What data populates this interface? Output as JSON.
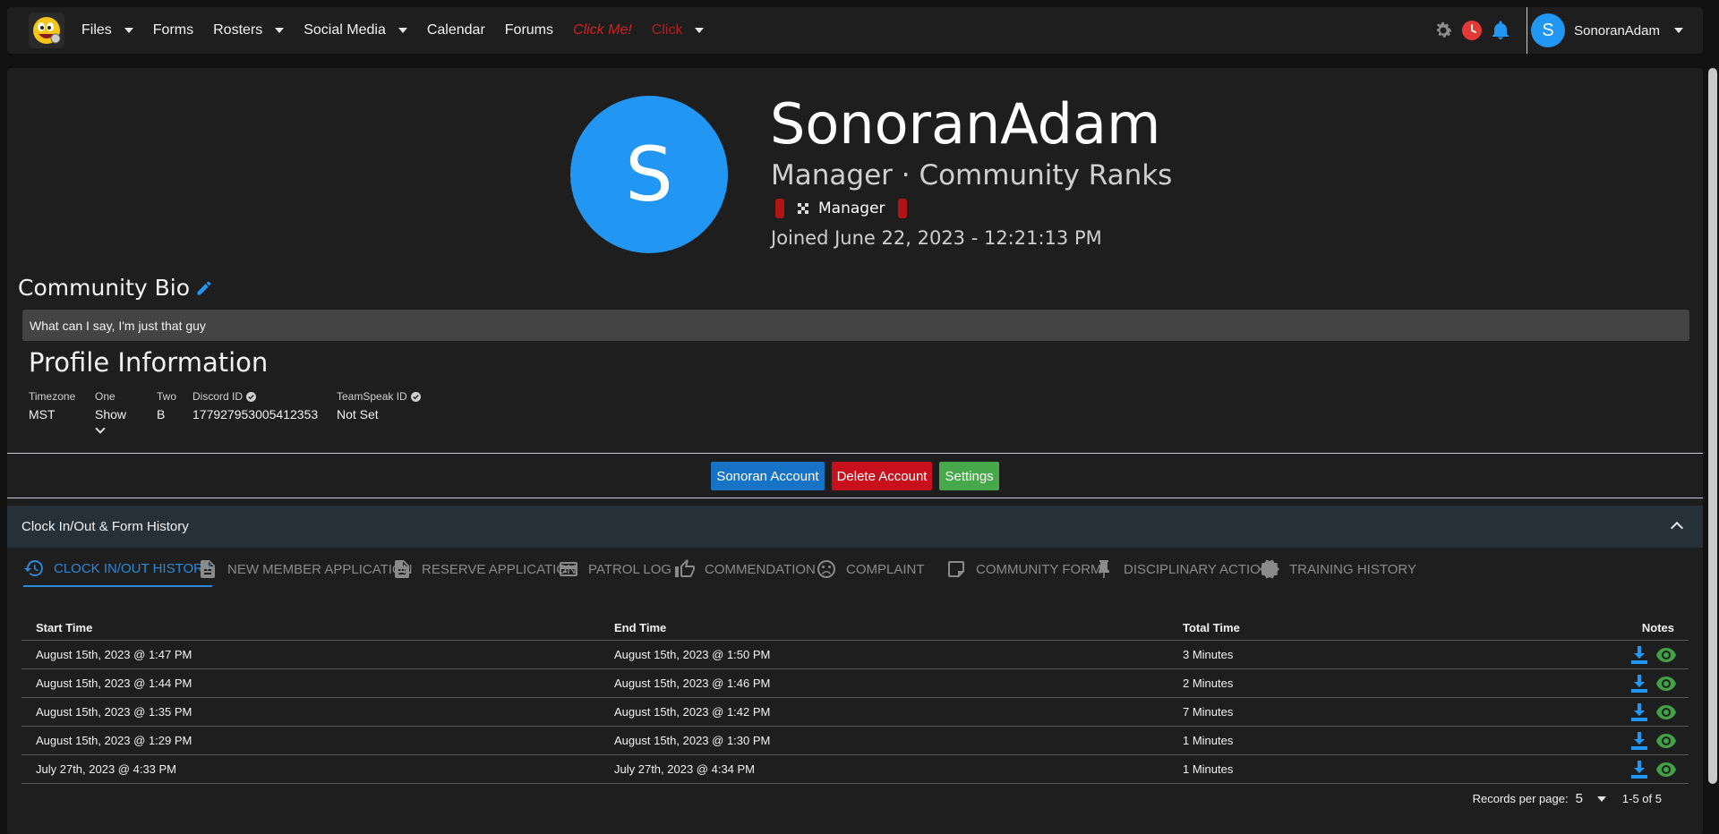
{
  "nav": {
    "items": [
      {
        "label": "Files",
        "dropdown": true
      },
      {
        "label": "Forms",
        "dropdown": false
      },
      {
        "label": "Rosters",
        "dropdown": true
      },
      {
        "label": "Social Media",
        "dropdown": true
      },
      {
        "label": "Calendar",
        "dropdown": false
      },
      {
        "label": "Forums",
        "dropdown": false
      },
      {
        "label": "Click Me!",
        "dropdown": false
      },
      {
        "label": "Click",
        "dropdown": true
      }
    ],
    "icons": [
      "gear-icon",
      "clock-icon",
      "bell-icon"
    ],
    "user": {
      "initial": "S",
      "name": "SonoranAdam"
    }
  },
  "profile": {
    "initial": "S",
    "name": "SonoranAdam",
    "rank_line": "Manager · Community Ranks",
    "badge": "Manager",
    "joined": "Joined June 22, 2023 - 12:21:13 PM"
  },
  "bio": {
    "title": "Community Bio",
    "text": "What can I say, I'm just that guy"
  },
  "profile_info": {
    "title": "Profile Information",
    "fields": [
      {
        "label": "Timezone",
        "value": "MST"
      },
      {
        "label": "One",
        "value": "Show"
      },
      {
        "label": "Two",
        "value": "B"
      },
      {
        "label": "Discord ID",
        "value": "177927953005412353"
      },
      {
        "label": "TeamSpeak ID",
        "value": "Not Set"
      }
    ]
  },
  "actions": {
    "sonoran_account": "Sonoran Account",
    "delete_account": "Delete Account",
    "settings": "Settings"
  },
  "history": {
    "title": "Clock In/Out & Form History",
    "tabs": [
      "CLOCK IN/OUT HISTORY",
      "NEW MEMBER APPLICATION",
      "RESERVE APPLICATION",
      "PATROL LOG",
      "COMMENDATION",
      "COMPLAINT",
      "COMMUNITY FORM",
      "DISCIPLINARY ACTION",
      "TRAINING HISTORY"
    ],
    "active_tab": "CLOCK IN/OUT HISTORY",
    "columns": [
      "Start Time",
      "End Time",
      "Total Time",
      "Notes"
    ],
    "rows": [
      [
        "August 15th, 2023 @ 1:47 PM",
        "August 15th, 2023 @ 1:50 PM",
        "3 Minutes"
      ],
      [
        "August 15th, 2023 @ 1:44 PM",
        "August 15th, 2023 @ 1:46 PM",
        "2 Minutes"
      ],
      [
        "August 15th, 2023 @ 1:35 PM",
        "August 15th, 2023 @ 1:42 PM",
        "7 Minutes"
      ],
      [
        "August 15th, 2023 @ 1:29 PM",
        "August 15th, 2023 @ 1:30 PM",
        "1 Minutes"
      ],
      [
        "July 27th, 2023 @ 4:33 PM",
        "July 27th, 2023 @ 4:34 PM",
        "1 Minutes"
      ]
    ],
    "pager": {
      "label": "Records per page:",
      "per_page": "5",
      "range": "1-5 of 5"
    }
  },
  "colors": {
    "accent_blue": "#2196f3",
    "danger": "#c8101c",
    "success": "#47a84b",
    "tab_active": "#2f87d8"
  }
}
